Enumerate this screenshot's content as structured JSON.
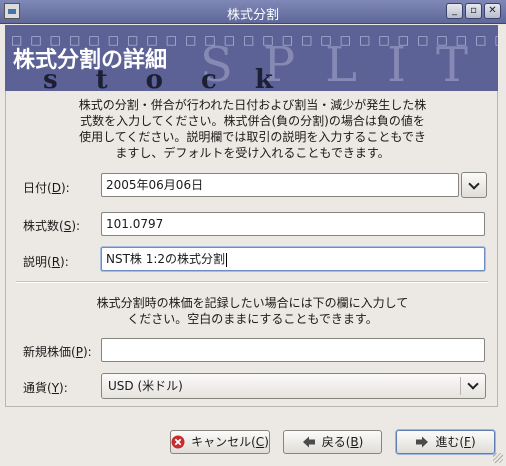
{
  "window": {
    "title": "株式分割",
    "controls": {
      "minimize": "_",
      "restore": "▫",
      "close": "✕"
    }
  },
  "banner": {
    "title": "株式分割の詳細",
    "stock_word": "stock",
    "split_word": "SPLIT",
    "decor_squares": "□□□□□□□□□□□□□□□□□□□□□□□□□□□"
  },
  "intro": {
    "lines": [
      "株式の分割・併合が行われた日付および割当・減少が発生した株",
      "式数を入力してください。株式併合(負の分割)の場合は負の値を",
      "使用してください。説明欄では取引の説明を入力することもでき",
      "ますし、デフォルトを受け入れることもできます。"
    ]
  },
  "form": {
    "date": {
      "label_pre": "日付(",
      "mnemonic": "D",
      "label_post": "):",
      "value": "2005年06月06日"
    },
    "shares": {
      "label_pre": "株式数(",
      "mnemonic": "S",
      "label_post": "):",
      "value": "101.0797"
    },
    "description": {
      "label_pre": "説明(",
      "mnemonic": "R",
      "label_post": "):",
      "value": "NST株 1:2の株式分割"
    }
  },
  "price_section": {
    "lines": [
      "株式分割時の株価を記録したい場合には下の欄に入力して",
      "ください。空白のままにすることもできます。"
    ],
    "new_price": {
      "label_pre": "新規株価(",
      "mnemonic": "P",
      "label_post": "):",
      "value": ""
    },
    "currency": {
      "label_pre": "通貨(",
      "mnemonic": "Y",
      "label_post": "):",
      "value": "USD (米ドル)"
    }
  },
  "buttons": {
    "cancel": {
      "label_pre": "キャンセル(",
      "mnemonic": "C",
      "label_post": ")"
    },
    "back": {
      "label_pre": "戻る(",
      "mnemonic": "B",
      "label_post": ")"
    },
    "forward": {
      "label_pre": "進む(",
      "mnemonic": "F",
      "label_post": ")"
    }
  },
  "colors": {
    "titlebar": "#6b74a6",
    "banner": "#5c6196",
    "dialog_bg": "#ece9e4"
  }
}
